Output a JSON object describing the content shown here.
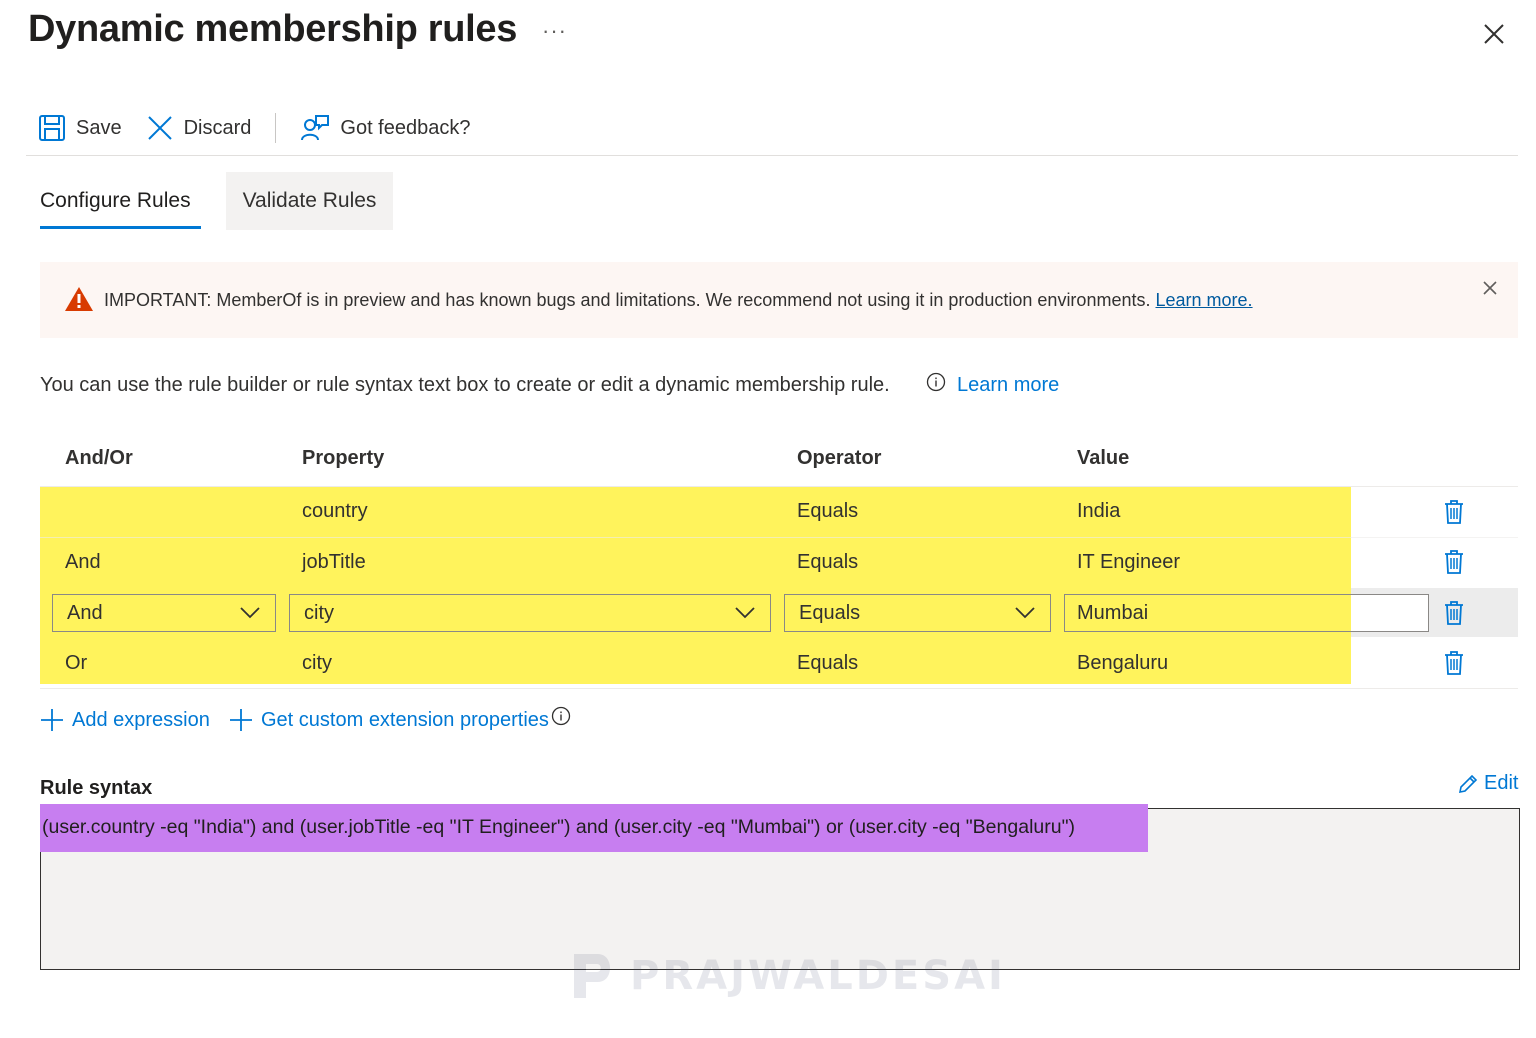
{
  "header": {
    "title": "Dynamic membership rules",
    "more_label": "···"
  },
  "toolbar": {
    "save_label": "Save",
    "discard_label": "Discard",
    "feedback_label": "Got feedback?"
  },
  "tabs": [
    {
      "label": "Configure Rules",
      "selected": true
    },
    {
      "label": "Validate Rules",
      "selected": false
    }
  ],
  "banner": {
    "text": "IMPORTANT: MemberOf is in preview and has known bugs and limitations. We recommend not using it in production environments.",
    "link_label": "Learn more."
  },
  "intro": {
    "text": "You can use the rule builder or rule syntax text box to create or edit a dynamic membership rule.",
    "link_label": "Learn more"
  },
  "rules_table": {
    "columns": [
      "And/Or",
      "Property",
      "Operator",
      "Value"
    ],
    "rows": [
      {
        "andor": "",
        "property": "country",
        "operator": "Equals",
        "value": "India"
      },
      {
        "andor": "And",
        "property": "jobTitle",
        "operator": "Equals",
        "value": "IT Engineer"
      },
      {
        "andor": "And",
        "property": "city",
        "operator": "Equals",
        "value": "Mumbai",
        "editing": true
      },
      {
        "andor": "Or",
        "property": "city",
        "operator": "Equals",
        "value": "Bengaluru"
      }
    ]
  },
  "actions": {
    "add_expression_label": "Add expression",
    "custom_ext_label": "Get custom extension properties"
  },
  "rule_syntax": {
    "label": "Rule syntax",
    "edit_label": "Edit",
    "text": "(user.country -eq \"India\") and (user.jobTitle -eq \"IT Engineer\") and (user.city -eq \"Mumbai\") or (user.city -eq \"Bengaluru\")"
  },
  "watermark": "PRAJWALDESAI",
  "colors": {
    "accent": "#0078d4",
    "highlight_yellow": "#fff35c",
    "highlight_purple": "#c77ef0",
    "warning": "#d83b01"
  }
}
